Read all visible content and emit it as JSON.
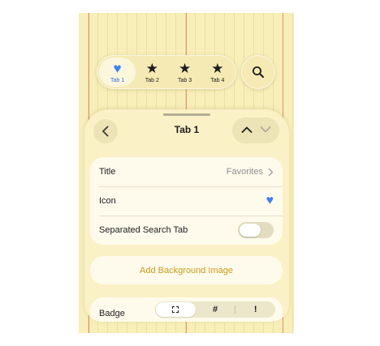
{
  "colors": {
    "accent_blue": "#3b82f6",
    "accent_gold": "#c99a1e",
    "paper": "#f7eeb8",
    "margin_line": "#e48a7a"
  },
  "tabbar": {
    "tabs": [
      {
        "label": "Tab 1",
        "icon": "heart-icon",
        "glyph": "♥",
        "selected": true
      },
      {
        "label": "Tab 2",
        "icon": "star-icon",
        "glyph": "★",
        "selected": false
      },
      {
        "label": "Tab 3",
        "icon": "star-icon",
        "glyph": "★",
        "selected": false
      },
      {
        "label": "Tab 4",
        "icon": "star-icon",
        "glyph": "★",
        "selected": false
      }
    ],
    "search_icon": "search-icon"
  },
  "sheet": {
    "title": "Tab 1",
    "back_icon": "chevron-left-icon",
    "up_icon": "chevron-up-icon",
    "down_icon": "chevron-down-icon",
    "rows": {
      "title_label": "Title",
      "title_value": "Favorites",
      "icon_label": "Icon",
      "icon_value_glyph": "♥",
      "separated_label": "Separated Search Tab",
      "separated_on": false
    },
    "add_background_label": "Add Background Image",
    "badge": {
      "label": "Badge",
      "options": [
        "none",
        "#",
        "!"
      ],
      "selected_index": 0
    }
  }
}
